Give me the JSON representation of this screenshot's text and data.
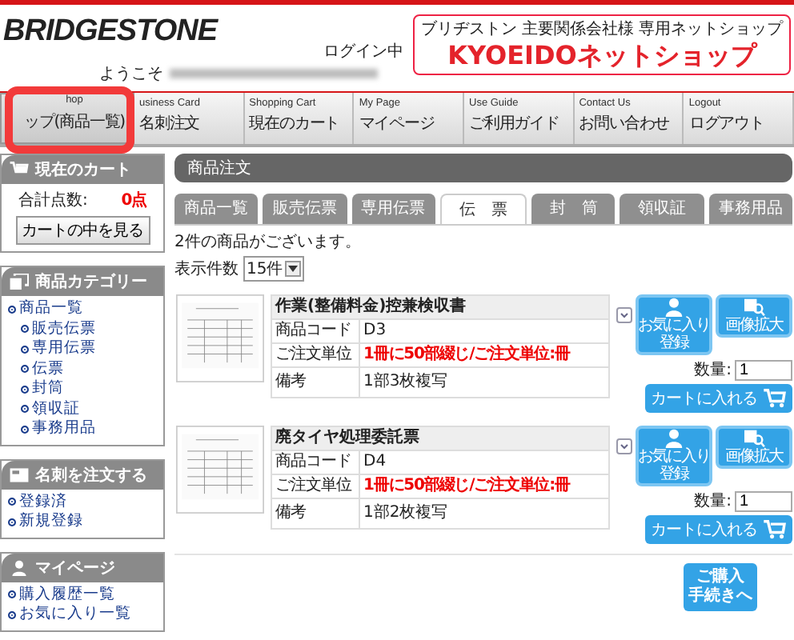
{
  "header": {
    "logo": "BRIDGESTONE",
    "login_status": "ログイン中",
    "welcome": "ようこそ",
    "banner": {
      "subtitle": "ブリヂストン 主要関係会社様 専用ネットショップ",
      "title": "KYOEIDOネットショップ"
    }
  },
  "nav": [
    {
      "en": "hop",
      "ja": "ップ(商品一覧)",
      "selected": true
    },
    {
      "en": "usiness Card",
      "ja": "名刺注文",
      "selected": false
    },
    {
      "en": "Shopping Cart",
      "ja": "現在のカート",
      "selected": false
    },
    {
      "en": "My Page",
      "ja": "マイページ",
      "selected": false
    },
    {
      "en": "Use Guide",
      "ja": "ご利用ガイド",
      "selected": false
    },
    {
      "en": "Contact Us",
      "ja": "お問い合わせ",
      "selected": false
    },
    {
      "en": "Logout",
      "ja": "ログアウト",
      "selected": false
    }
  ],
  "sidebar": {
    "cart": {
      "title": "現在のカート",
      "total_label": "合計点数:",
      "total_value": "0点",
      "button": "カートの中を見る"
    },
    "sections": [
      {
        "title": "商品カテゴリー",
        "items": [
          {
            "label": "商品一覧",
            "children": [
              {
                "label": "販売伝票"
              },
              {
                "label": "専用伝票"
              },
              {
                "label": "伝票"
              },
              {
                "label": "封筒"
              },
              {
                "label": "領収証"
              },
              {
                "label": "事務用品"
              }
            ]
          }
        ]
      },
      {
        "title": "名刺を注文する",
        "items": [
          {
            "label": "登録済"
          },
          {
            "label": "新規登録"
          }
        ]
      },
      {
        "title": "マイページ",
        "items": [
          {
            "label": "購入履歴一覧"
          },
          {
            "label": "お気に入り一覧"
          }
        ]
      }
    ]
  },
  "main": {
    "title": "商品注文",
    "tabs": [
      {
        "label": "商品一覧",
        "selected": false
      },
      {
        "label": "販売伝票",
        "selected": false
      },
      {
        "label": "専用伝票",
        "selected": false
      },
      {
        "label": "伝　票",
        "selected": true
      },
      {
        "label": "封　筒",
        "selected": false
      },
      {
        "label": "領収証",
        "selected": false
      },
      {
        "label": "事務用品",
        "selected": false
      }
    ],
    "count_text": "2件の商品がございます。",
    "per_page": {
      "label": "表示件数",
      "value": "15件"
    },
    "products": [
      {
        "name": "作業(整備料金)控兼検収書",
        "code_label": "商品コード",
        "code": "D3",
        "unit_label": "ご注文単位",
        "unit": "1冊に50部綴じ/ご注文単位:冊",
        "note_label": "備考",
        "note": "1部3枚複写",
        "fav_button": [
          "お気に入り",
          "登録"
        ],
        "zoom_button": "画像拡大",
        "quantity_label": "数量:",
        "quantity": "1",
        "cart_button": "カートに入れる"
      },
      {
        "name": "廃タイヤ処理委託票",
        "code_label": "商品コード",
        "code": "D4",
        "unit_label": "ご注文単位",
        "unit": "1冊に50部綴じ/ご注文単位:冊",
        "note_label": "備考",
        "note": "1部2枚複写",
        "fav_button": [
          "お気に入り",
          "登録"
        ],
        "zoom_button": "画像拡大",
        "quantity_label": "数量:",
        "quantity": "1",
        "cart_button": "カートに入れる"
      }
    ],
    "purchase_button": [
      "ご購入",
      "手続きへ"
    ]
  }
}
